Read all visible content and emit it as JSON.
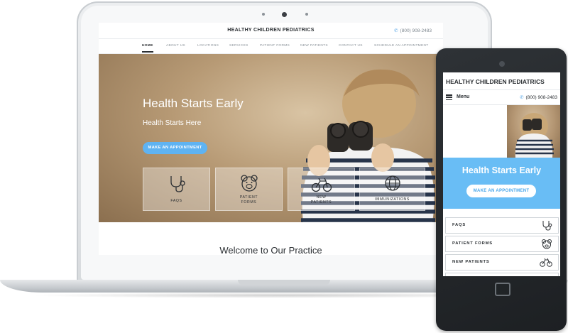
{
  "desktop": {
    "brand": "HEALTHY CHILDREN PEDIATRICS",
    "phone": "(800) 908-2483",
    "nav": [
      {
        "label": "HOME",
        "active": true
      },
      {
        "label": "ABOUT US"
      },
      {
        "label": "LOCATIONS"
      },
      {
        "label": "SERVICES"
      },
      {
        "label": "PATIENT FORMS"
      },
      {
        "label": "NEW PATIENTS"
      },
      {
        "label": "CONTACT US"
      },
      {
        "label": "SCHEDULE AN APPOINTMENT"
      }
    ],
    "hero": {
      "title": "Health Starts Early",
      "subtitle": "Health Starts Here",
      "cta": "MAKE AN APPOINTMENT"
    },
    "cards": [
      {
        "label": "FAQS",
        "icon": "stethoscope-icon"
      },
      {
        "label_line1": "PATIENT",
        "label_line2": "FORMS",
        "icon": "teddy-bear-icon"
      },
      {
        "label_line1": "NEW",
        "label_line2": "PATIENTS",
        "icon": "tricycle-icon"
      },
      {
        "label": "IMMUNIZATIONS",
        "icon": "globe-icon"
      }
    ],
    "welcome": "Welcome to Our Practice"
  },
  "mobile": {
    "brand": "HEALTHY CHILDREN PEDIATRICS",
    "menu": "Menu",
    "phone": "(800) 908-2483",
    "hero_title": "Health Starts Early",
    "cta": "MAKE AN APPOINTMENT",
    "items": [
      {
        "label": "FAQS",
        "icon": "stethoscope-icon"
      },
      {
        "label": "PATIENT FORMS",
        "icon": "teddy-bear-icon"
      },
      {
        "label": "NEW PATIENTS",
        "icon": "tricycle-icon"
      }
    ]
  },
  "colors": {
    "accent_blue": "#5fb3f2",
    "mobile_banner": "#69bdf5",
    "text_dark": "#2b2f33"
  }
}
